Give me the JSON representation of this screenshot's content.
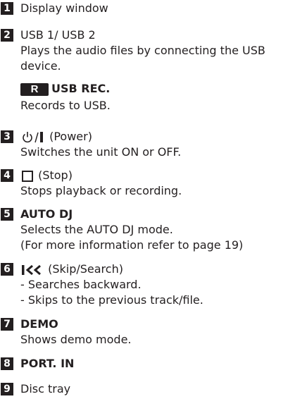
{
  "items": [
    {
      "number": "1",
      "title": "Display window"
    },
    {
      "number": "2",
      "title": "USB 1/ USB 2",
      "desc1": "Plays the audio files by connecting the USB",
      "desc2": "device.",
      "sub_badge": "R",
      "sub_title": "USB REC.",
      "sub_desc": "Records to USB."
    },
    {
      "number": "3",
      "title": "(Power)",
      "icon": "power-icon",
      "desc1": "Switches the unit ON or OFF."
    },
    {
      "number": "4",
      "title": "(Stop)",
      "icon": "stop-icon",
      "desc1": "Stops playback or recording."
    },
    {
      "number": "5",
      "title": "AUTO DJ",
      "desc1": "Selects the AUTO DJ mode.",
      "desc2": "(For more information refer to page 19)"
    },
    {
      "number": "6",
      "title": "(Skip/Search)",
      "icon": "skip-back-icon",
      "desc1": "- Searches backward.",
      "desc2": "- Skips to the previous track/file."
    },
    {
      "number": "7",
      "title": "DEMO",
      "desc1": "Shows demo mode."
    },
    {
      "number": "8",
      "title": "PORT. IN"
    },
    {
      "number": "9",
      "title": "Disc tray"
    }
  ]
}
